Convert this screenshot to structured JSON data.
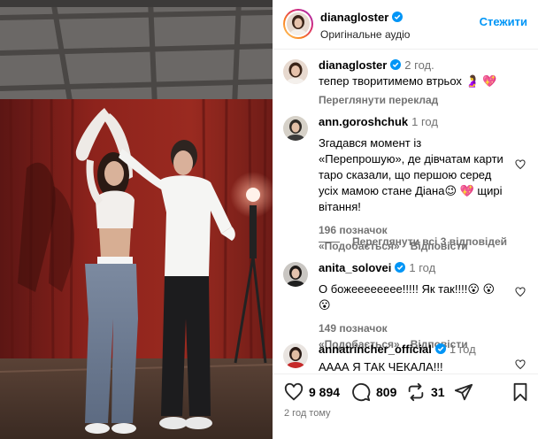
{
  "post": {
    "author": "dianagloster",
    "audio": "Оригінальне аудіо",
    "follow_label": "Стежити",
    "caption_time": "2 год.",
    "caption_text": "тепер творитимемо втрьох 🤰 💖",
    "translate_label": "Переглянути переклад",
    "age": "2 год тому"
  },
  "comments": [
    {
      "user": "ann.goroshchuk",
      "time": "1 год",
      "text": "Згадався момент із «Перепрошую», де дівчатам карти таро сказали, що першою серед усіх мамою стане Діана😉 💖 щирі вітання!",
      "likes": "196 позначок «Подобається»",
      "reply_label": "Відповісти",
      "view_replies": "Переглянути всі 3 відповідей"
    },
    {
      "user": "anita_solovei",
      "time": "1 год",
      "text": "О божееееееее!!!!! Як так!!!!😮 😮 😮",
      "likes": "149 позначок «Подобається»",
      "reply_label": "Відповісти"
    },
    {
      "user": "annatrincher_official",
      "time": "1 год",
      "text": "АААА Я ТАК ЧЕКАЛА!!!"
    }
  ],
  "actions": {
    "likes": "9 894",
    "comments": "809",
    "reposts": "31"
  },
  "icons": {
    "verified": "verified-badge-icon",
    "like": "heart-icon",
    "comment": "comment-bubble-icon",
    "repost": "repost-icon",
    "share": "paper-plane-icon",
    "save": "bookmark-icon"
  },
  "colors": {
    "accent": "#0095f6",
    "verified": "#0095f6",
    "muted": "#737373"
  }
}
